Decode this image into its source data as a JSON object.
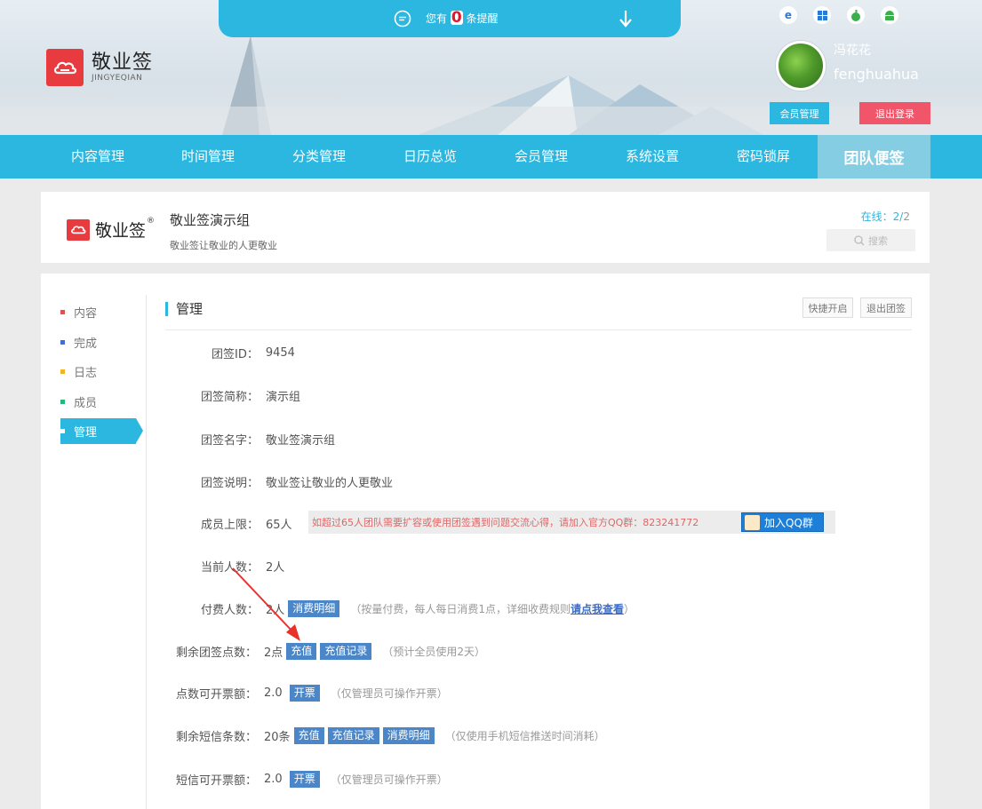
{
  "notify": {
    "prefix": "您有",
    "count": "0",
    "suffix": "条提醒"
  },
  "logo": {
    "name_cn": "敬业签",
    "name_en": "JINGYEQIAN"
  },
  "user": {
    "name_cn": "冯花花",
    "name_en": "fenghuahua",
    "member_label": "会员管理",
    "logout_label": "退出登录"
  },
  "nav": {
    "items": [
      "内容管理",
      "时间管理",
      "分类管理",
      "日历总览",
      "会员管理",
      "系统设置",
      "密码锁屏"
    ],
    "active": "团队便签"
  },
  "group": {
    "logo_cn": "敬业签",
    "logo_r": "®",
    "title": "敬业签演示组",
    "subtitle": "敬业签让敬业的人更敬业",
    "online_label": "在线：",
    "online_count": "2/",
    "online_total": "2",
    "search_placeholder": "搜索"
  },
  "sidebar": {
    "items": [
      {
        "label": "内容",
        "color": "#e84c4c"
      },
      {
        "label": "完成",
        "color": "#3c6ee0"
      },
      {
        "label": "日志",
        "color": "#f0b429"
      },
      {
        "label": "成员",
        "color": "#28b67a"
      },
      {
        "label": "管理",
        "color": "#ffffff"
      }
    ]
  },
  "section": {
    "title": "管理",
    "quick_open": "快捷开启",
    "exit_group": "退出团签"
  },
  "fields": {
    "group_id": {
      "label": "团签ID：",
      "value": "9454"
    },
    "short_name": {
      "label": "团签简称：",
      "value": "演示组"
    },
    "full_name": {
      "label": "团签名字：",
      "value": "敬业签演示组"
    },
    "description": {
      "label": "团签说明：",
      "value": "敬业签让敬业的人更敬业"
    },
    "member_limit": {
      "label": "成员上限：",
      "value": "65人",
      "warning": "如超过65人团队需要扩容或使用团签遇到问题交流心得，请加入官方QQ群：823241772",
      "qq_button": "加入QQ群"
    },
    "current_members": {
      "label": "当前人数：",
      "value": "2人"
    },
    "paid_members": {
      "label": "付费人数：",
      "value": "2人",
      "tag": "消费明细",
      "hint_prefix": "（按量付费，每人每日消费1点，详细收费规则",
      "hint_link": "请点我查看",
      "hint_suffix": "）"
    },
    "points": {
      "label": "剩余团签点数：",
      "value": "2点",
      "tag1": "充值",
      "tag2": "充值记录",
      "hint": "（预计全员使用2天）"
    },
    "point_invoice": {
      "label": "点数可开票额：",
      "value": "2.0",
      "tag": "开票",
      "hint": "（仅管理员可操作开票）"
    },
    "sms": {
      "label": "剩余短信条数：",
      "value": "20条",
      "tag1": "充值",
      "tag2": "充值记录",
      "tag3": "消费明细",
      "hint": "（仅使用手机短信推送时间消耗）"
    },
    "sms_invoice": {
      "label": "短信可开票额：",
      "value": "2.0",
      "tag": "开票",
      "hint": "（仅管理员可操作开票）"
    }
  },
  "colors": {
    "accent": "#2bb7df",
    "tag": "#4a86c8",
    "logout": "#f0556a",
    "brand_red": "#e83b3f"
  }
}
